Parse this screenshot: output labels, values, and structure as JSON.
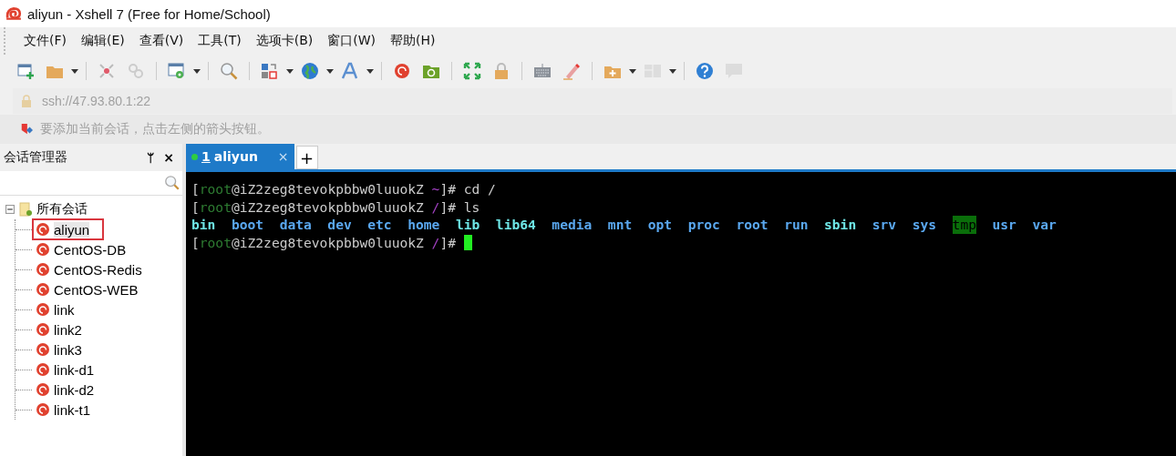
{
  "window": {
    "title": "aliyun - Xshell 7 (Free for Home/School)"
  },
  "menu": [
    "文件(F)",
    "编辑(E)",
    "查看(V)",
    "工具(T)",
    "选项卡(B)",
    "窗口(W)",
    "帮助(H)"
  ],
  "address": {
    "value": "ssh://47.93.80.1:22"
  },
  "hint": "要添加当前会话，点击左侧的箭头按钮。",
  "sidebar": {
    "title": "会话管理器",
    "pin": "ᛘ",
    "close": "×",
    "tree": [
      {
        "label": "所有会话",
        "expanded": true,
        "children": [
          {
            "label": "aliyun",
            "selected": true
          },
          {
            "label": "CentOS-DB",
            "selected": false
          },
          {
            "label": "CentOS-Redis",
            "selected": false
          },
          {
            "label": "CentOS-WEB",
            "selected": false
          },
          {
            "label": "link",
            "selected": false
          },
          {
            "label": "link2",
            "selected": false
          },
          {
            "label": "link3",
            "selected": false
          },
          {
            "label": "link-d1",
            "selected": false
          },
          {
            "label": "link-d2",
            "selected": false
          },
          {
            "label": "link-t1",
            "selected": false
          }
        ]
      }
    ]
  },
  "tabs": [
    {
      "number": "1",
      "label": "aliyun",
      "selected": true,
      "connected": true,
      "close": "×"
    }
  ],
  "add_tab": "+",
  "terminal": {
    "lines": [
      {
        "kind": "prompt",
        "open": "[",
        "user": "root",
        "host": "@iZ2zeg8tevokpbbw0luuokZ",
        "path": "~",
        "end": "]#",
        "command": "cd /"
      },
      {
        "kind": "prompt",
        "open": "[",
        "user": "root",
        "host": "@iZ2zeg8tevokpbbw0luuokZ",
        "path": "/",
        "end": "]#",
        "command": "ls"
      },
      {
        "kind": "listing",
        "entries": [
          {
            "name": "bin",
            "kind": "link"
          },
          {
            "name": "boot",
            "kind": "dir"
          },
          {
            "name": "data",
            "kind": "dir"
          },
          {
            "name": "dev",
            "kind": "dir"
          },
          {
            "name": "etc",
            "kind": "dir"
          },
          {
            "name": "home",
            "kind": "dir"
          },
          {
            "name": "lib",
            "kind": "link"
          },
          {
            "name": "lib64",
            "kind": "link"
          },
          {
            "name": "media",
            "kind": "dir"
          },
          {
            "name": "mnt",
            "kind": "dir"
          },
          {
            "name": "opt",
            "kind": "dir"
          },
          {
            "name": "proc",
            "kind": "dir"
          },
          {
            "name": "root",
            "kind": "dir"
          },
          {
            "name": "run",
            "kind": "dir"
          },
          {
            "name": "sbin",
            "kind": "link"
          },
          {
            "name": "srv",
            "kind": "dir"
          },
          {
            "name": "sys",
            "kind": "dir"
          },
          {
            "name": "tmp",
            "kind": "sticky"
          },
          {
            "name": "usr",
            "kind": "dir"
          },
          {
            "name": "var",
            "kind": "dir"
          }
        ]
      },
      {
        "kind": "prompt",
        "open": "[",
        "user": "root",
        "host": "@iZ2zeg8tevokpbbw0luuokZ",
        "path": "/",
        "end": "]#",
        "cursor": true
      }
    ]
  }
}
